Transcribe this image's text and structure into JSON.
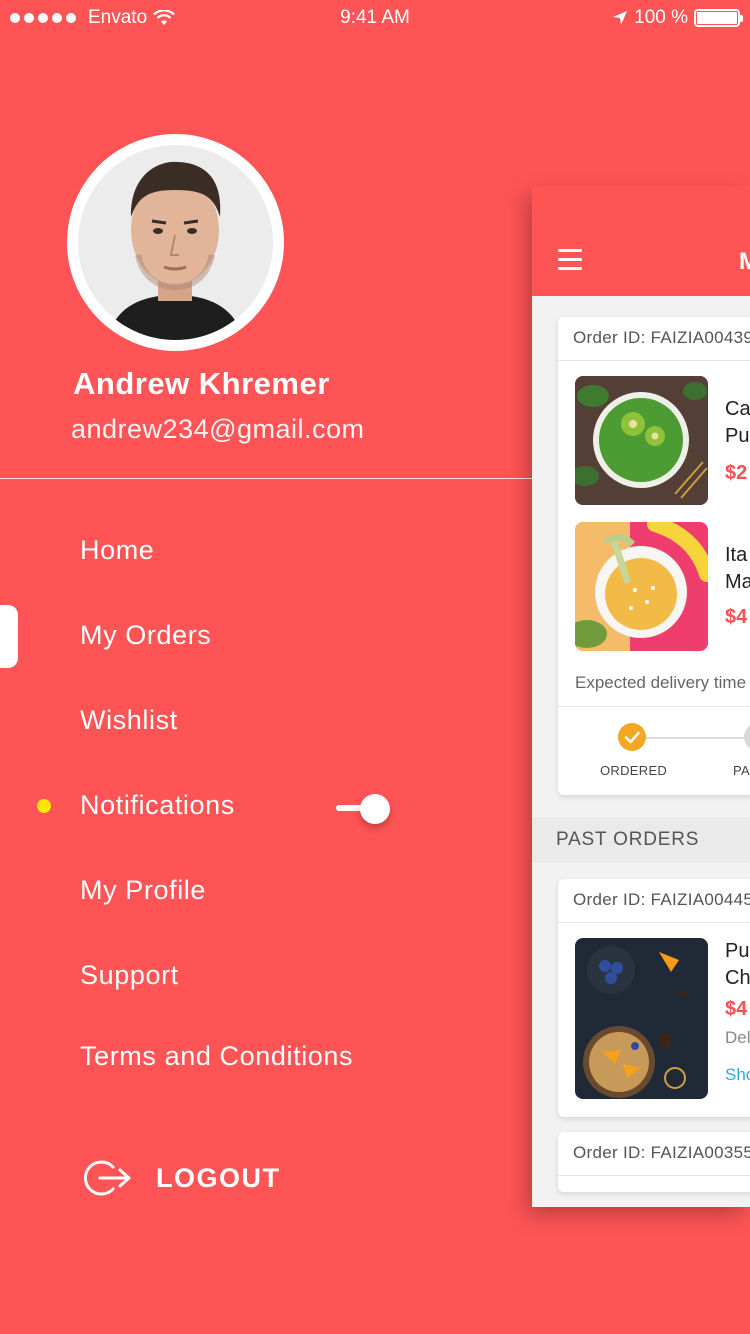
{
  "status_bar": {
    "carrier": "Envato",
    "time": "9:41 AM",
    "battery": "100 %"
  },
  "profile": {
    "name": "Andrew Khremer",
    "email": "andrew234@gmail.com"
  },
  "menu": {
    "items": [
      {
        "label": "Home"
      },
      {
        "label": "My Orders"
      },
      {
        "label": "Wishlist"
      },
      {
        "label": "Notifications"
      },
      {
        "label": "My Profile"
      },
      {
        "label": "Support"
      },
      {
        "label": "Terms and Conditions"
      }
    ],
    "logout": "LOGOUT",
    "notifications_toggle": "on"
  },
  "main_panel": {
    "header_title": "M",
    "current_order": {
      "order_id": "Order ID: FAIZIA00439",
      "items": [
        {
          "name_line1": "Ca",
          "name_line2": "Pu",
          "price": "$2"
        },
        {
          "name_line1": "Ita",
          "name_line2": "Ma",
          "price": "$4"
        }
      ],
      "expected": "Expected delivery time",
      "steps": [
        "ORDERED",
        "PA"
      ]
    },
    "past_orders_title": "PAST ORDERS",
    "past_orders": [
      {
        "order_id": "Order ID: FAIZIA00445",
        "name_line1": "Pu",
        "name_line2": "Ch",
        "price": "$4",
        "status": "Del",
        "link": "Sho"
      },
      {
        "order_id": "Order ID: FAIZIA00355"
      }
    ]
  },
  "colors": {
    "brand": "#ff5455",
    "accent_yellow": "#ffe600",
    "step_done": "#f5a623",
    "link": "#2aaae2"
  }
}
